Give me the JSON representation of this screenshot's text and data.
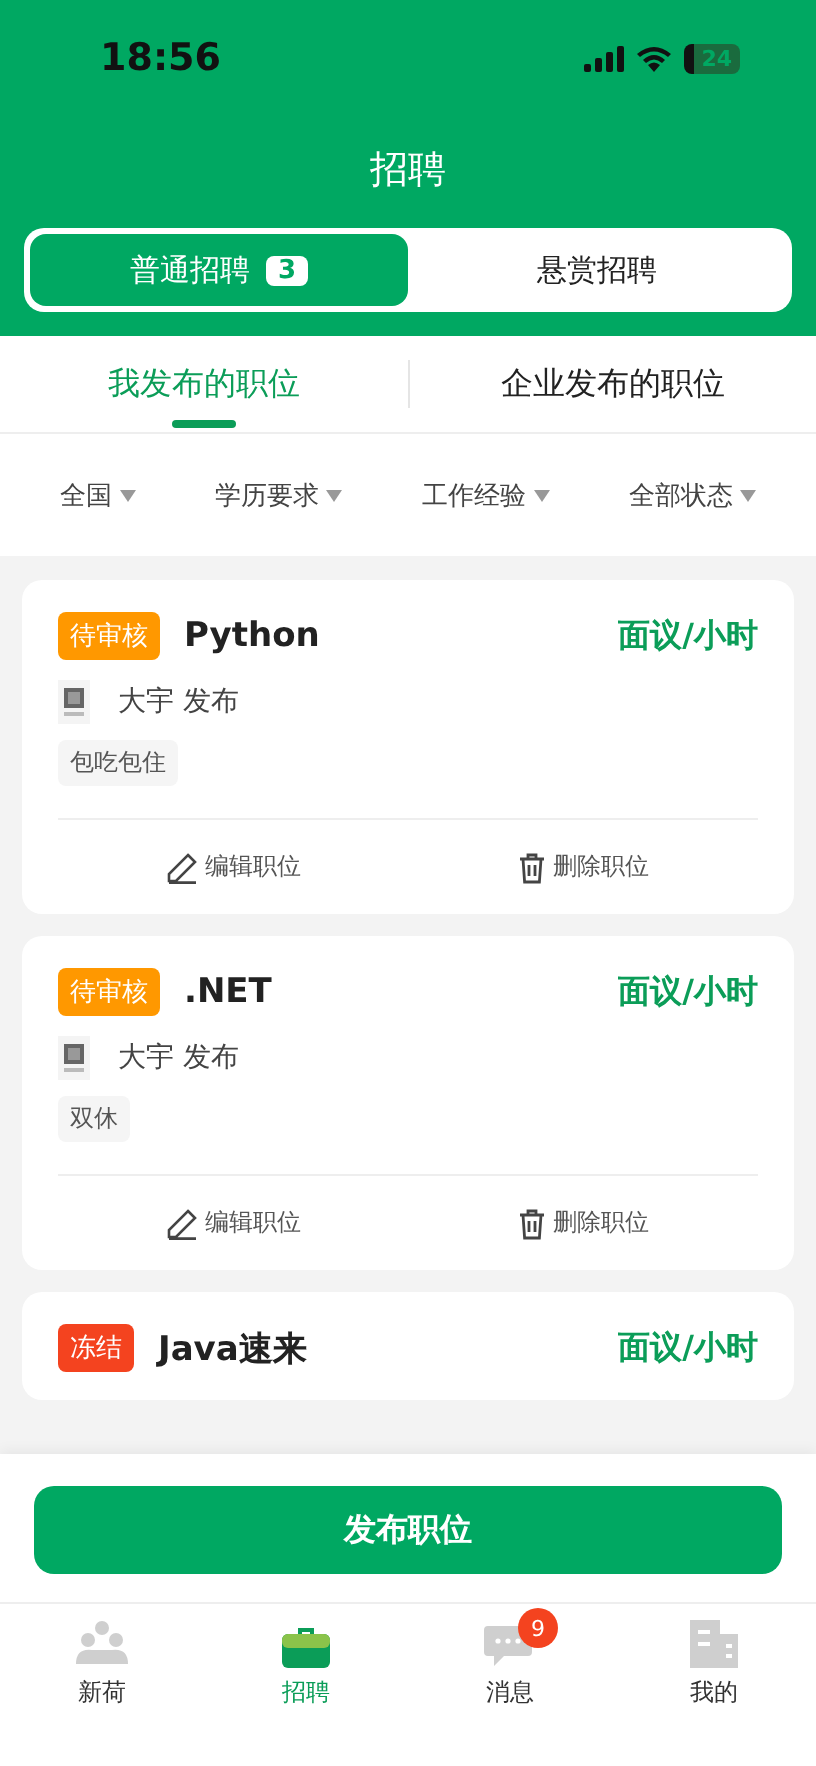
{
  "status_bar": {
    "time": "18:56",
    "battery": "24"
  },
  "header": {
    "title": "招聘"
  },
  "segments": [
    {
      "label": "普通招聘",
      "count": "3",
      "selected": true
    },
    {
      "label": "悬赏招聘",
      "selected": false
    }
  ],
  "tabs": [
    {
      "label": "我发布的职位",
      "selected": true
    },
    {
      "label": "企业发布的职位",
      "selected": false
    }
  ],
  "filters": [
    {
      "label": "全国"
    },
    {
      "label": "学历要求"
    },
    {
      "label": "工作经验"
    },
    {
      "label": "全部状态"
    }
  ],
  "jobs": [
    {
      "status": {
        "label": "待审核",
        "kind": "pending"
      },
      "title": "Python",
      "salary": "面议/小时",
      "publisher": "大宇 发布",
      "tags": [
        "包吃包住"
      ],
      "actions": [
        {
          "kind": "edit",
          "label": "编辑职位"
        },
        {
          "kind": "delete",
          "label": "删除职位"
        }
      ]
    },
    {
      "status": {
        "label": "待审核",
        "kind": "pending"
      },
      "title": ".NET",
      "salary": "面议/小时",
      "publisher": "大宇 发布",
      "tags": [
        "双休"
      ],
      "actions": [
        {
          "kind": "edit",
          "label": "编辑职位"
        },
        {
          "kind": "delete",
          "label": "删除职位"
        }
      ]
    },
    {
      "status": {
        "label": "冻结",
        "kind": "frozen"
      },
      "title": "Java速来",
      "salary": "面议/小时"
    }
  ],
  "publish_button": "发布职位",
  "nav": [
    {
      "kind": "people",
      "label": "新荷",
      "selected": false
    },
    {
      "kind": "briefcase",
      "label": "招聘",
      "selected": true
    },
    {
      "kind": "chat",
      "label": "消息",
      "selected": false,
      "badge": "9"
    },
    {
      "kind": "building",
      "label": "我的",
      "selected": false
    }
  ]
}
